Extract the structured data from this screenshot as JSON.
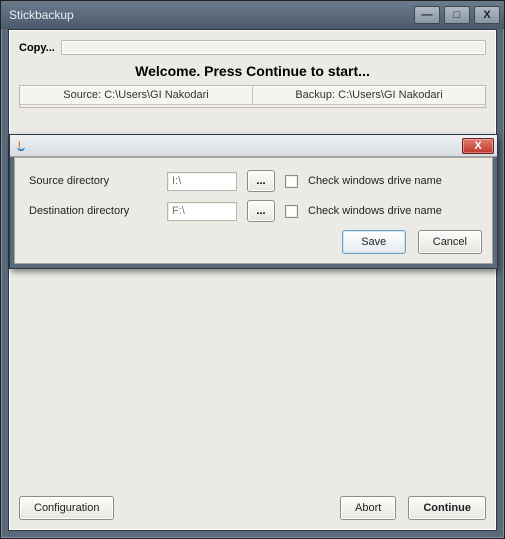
{
  "window": {
    "title": "Stickbackup",
    "buttons": {
      "min": "—",
      "max": "□",
      "close": "X"
    }
  },
  "main": {
    "copy_label": "Copy...",
    "welcome": "Welcome. Press Continue to start...",
    "columns": {
      "source": "Source: C:\\Users\\GI Nakodari",
      "backup": "Backup: C:\\Users\\GI Nakodari"
    },
    "footer": {
      "configuration": "Configuration",
      "abort": "Abort",
      "continue": "Continue"
    }
  },
  "dialog": {
    "close": "X",
    "rows": {
      "source": {
        "label": "Source directory",
        "value": "I:\\",
        "browse": "...",
        "check_label": "Check windows drive name"
      },
      "dest": {
        "label": "Destination directory",
        "value": "F:\\",
        "browse": "...",
        "check_label": "Check windows drive name"
      }
    },
    "footer": {
      "save": "Save",
      "cancel": "Cancel"
    }
  }
}
